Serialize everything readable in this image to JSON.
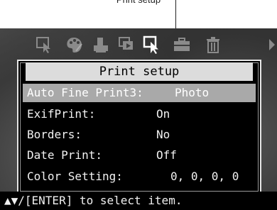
{
  "callout": {
    "text": "Print setup"
  },
  "toolbar": {
    "icons": [
      "select-frame-icon",
      "palette-icon",
      "print-icon",
      "slideshow-icon",
      "print-setup-icon",
      "toolbox-icon",
      "trash-icon",
      "next-arrow-icon"
    ]
  },
  "dialog": {
    "title": "Print setup",
    "items": [
      {
        "label": "Auto Fine Print3:",
        "value": "Photo"
      },
      {
        "label": "ExifPrint:",
        "value": "On"
      },
      {
        "label": "Borders:",
        "value": "No"
      },
      {
        "label": "Date Print:",
        "value": "Off"
      },
      {
        "label": "Color Setting:",
        "value": "0, 0, 0, 0"
      }
    ]
  },
  "status": {
    "hint": "▲▼/[ENTER] to select item."
  },
  "colors": {
    "title_bar": "#dcdcdc",
    "selected_row": "#a9a9a9",
    "panel_bg": "#000000",
    "icon_gray": "#8a8a8a",
    "icon_active": "#ffffff"
  }
}
